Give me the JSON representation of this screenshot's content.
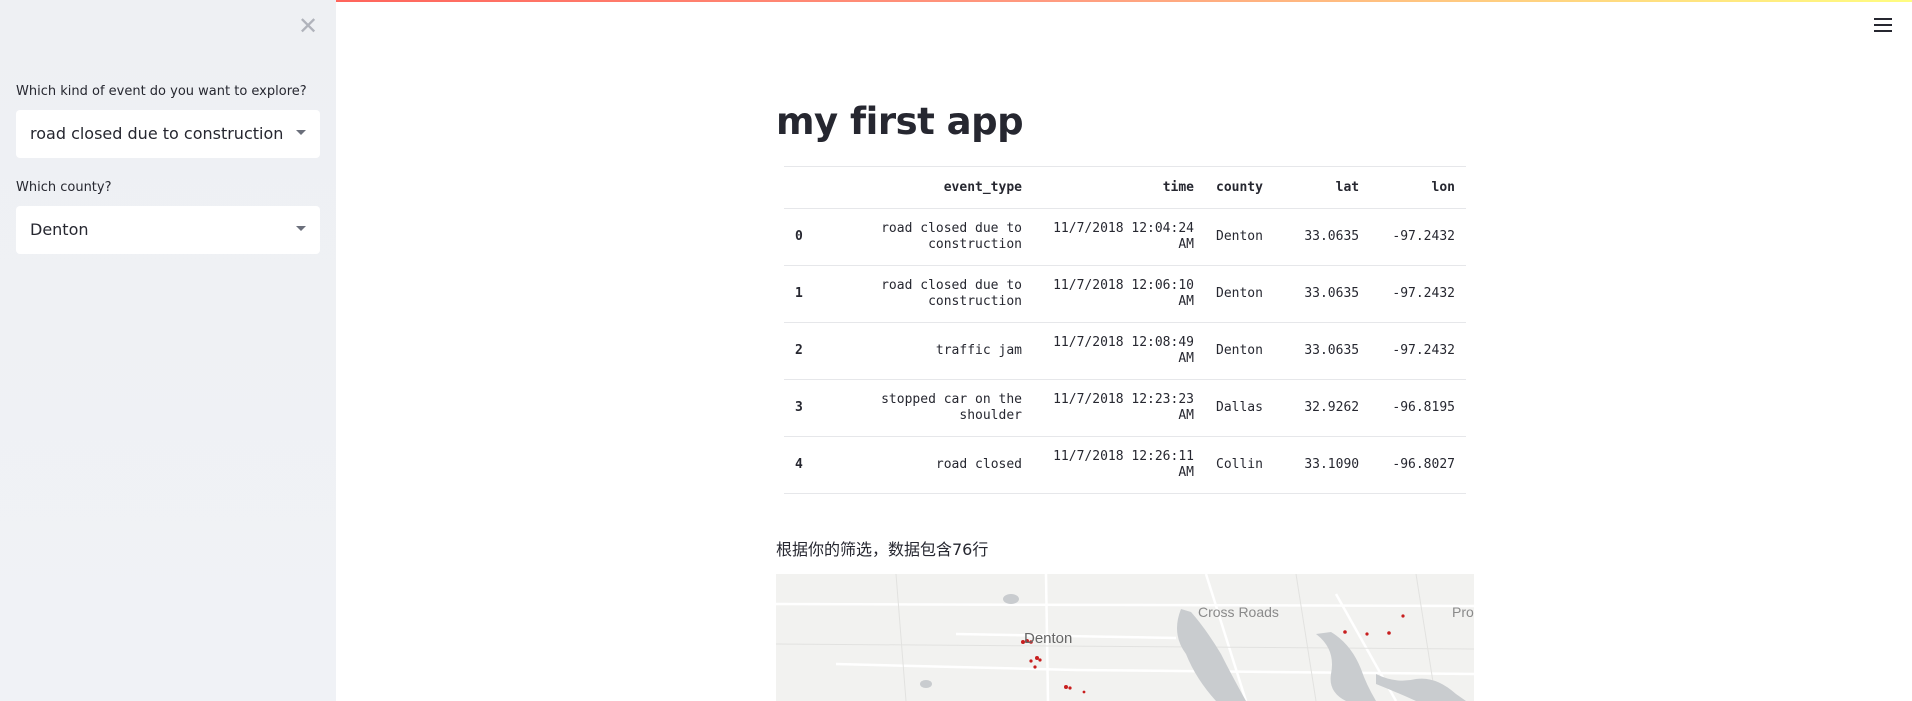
{
  "sidebar": {
    "close_icon": "close-icon",
    "event_select": {
      "label": "Which kind of event do you want to explore?",
      "value": "road closed due to construction"
    },
    "county_select": {
      "label": "Which county?",
      "value": "Denton"
    }
  },
  "header": {
    "menu_icon": "hamburger-menu-icon"
  },
  "main": {
    "title": "my first app",
    "table": {
      "columns": [
        "",
        "event_type",
        "time",
        "county",
        "lat",
        "lon"
      ],
      "rows": [
        {
          "idx": "0",
          "event_type": "road closed due to construction",
          "time": "11/7/2018 12:04:24 AM",
          "county": "Denton",
          "lat": "33.0635",
          "lon": "-97.2432"
        },
        {
          "idx": "1",
          "event_type": "road closed due to construction",
          "time": "11/7/2018 12:06:10 AM",
          "county": "Denton",
          "lat": "33.0635",
          "lon": "-97.2432"
        },
        {
          "idx": "2",
          "event_type": "traffic jam",
          "time": "11/7/2018 12:08:49 AM",
          "county": "Denton",
          "lat": "33.0635",
          "lon": "-97.2432"
        },
        {
          "idx": "3",
          "event_type": "stopped car on the shoulder",
          "time": "11/7/2018 12:23:23 AM",
          "county": "Dallas",
          "lat": "32.9262",
          "lon": "-96.8195"
        },
        {
          "idx": "4",
          "event_type": "road closed",
          "time": "11/7/2018 12:26:11 AM",
          "county": "Collin",
          "lat": "33.1090",
          "lon": "-96.8027"
        }
      ]
    },
    "summary": "根据你的筛选，数据包含76行",
    "map": {
      "labels": {
        "denton": "Denton",
        "cross_roads": "Cross Roads",
        "pro": "Pro"
      },
      "point_color": "#c81e1e"
    }
  }
}
